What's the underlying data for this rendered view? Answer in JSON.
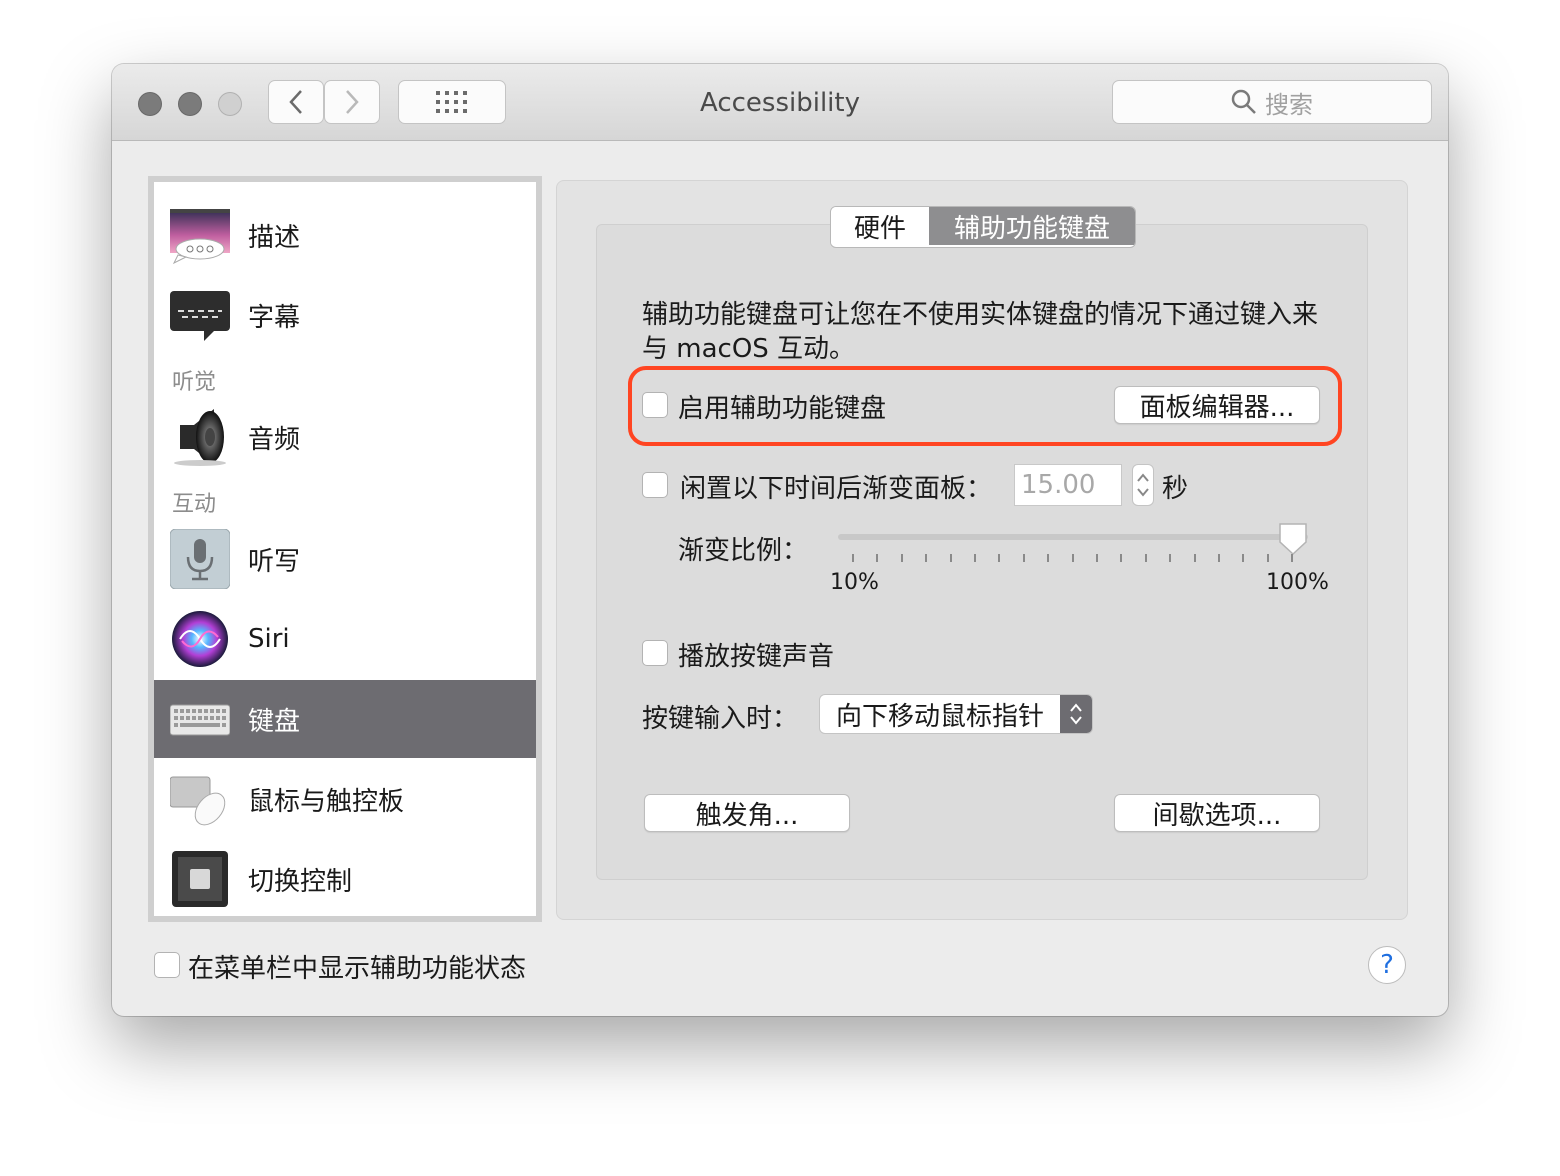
{
  "window": {
    "title": "Accessibility",
    "search_placeholder": "搜索"
  },
  "sidebar": {
    "items": [
      {
        "label": "描述",
        "icon": "descriptions-icon"
      },
      {
        "label": "字幕",
        "icon": "captions-icon"
      },
      {
        "label": "音频",
        "icon": "speaker-icon"
      },
      {
        "label": "听写",
        "icon": "microphone-icon"
      },
      {
        "label": "Siri",
        "icon": "siri-icon"
      },
      {
        "label": "键盘",
        "icon": "keyboard-icon",
        "selected": true
      },
      {
        "label": "鼠标与触控板",
        "icon": "mouse-trackpad-icon"
      },
      {
        "label": "切换控制",
        "icon": "switch-control-icon"
      }
    ],
    "headers": [
      "听觉",
      "互动"
    ]
  },
  "tabs": [
    {
      "label": "硬件",
      "selected": false
    },
    {
      "label": "辅助功能键盘",
      "selected": true
    }
  ],
  "content": {
    "description": "辅助功能键盘可让您在不使用实体键盘的情况下通过键入来与 macOS 互动。",
    "enable_keyboard_label": "启用辅助功能键盘",
    "enable_keyboard_checked": false,
    "panel_editor_button": "面板编辑器...",
    "fade_label": "闲置以下时间后渐变面板：",
    "fade_checked": false,
    "fade_value": "15.00",
    "fade_unit": "秒",
    "fade_ratio_label": "渐变比例：",
    "slider_min_label": "10%",
    "slider_max_label": "100%",
    "slider_value_percent": 100,
    "key_sound_label": "播放按键声音",
    "key_sound_checked": false,
    "on_key_input_label": "按键输入时：",
    "on_key_input_value": "向下移动鼠标指针",
    "hot_corners_button": "触发角...",
    "dwell_options_button": "间歇选项..."
  },
  "footer": {
    "show_status_label": "在菜单栏中显示辅助功能状态",
    "show_status_checked": false,
    "help_label": "?"
  },
  "colors": {
    "selection": "#6d6c71",
    "highlight_ring": "#ff4522",
    "help_blue": "#1f6fe0"
  }
}
